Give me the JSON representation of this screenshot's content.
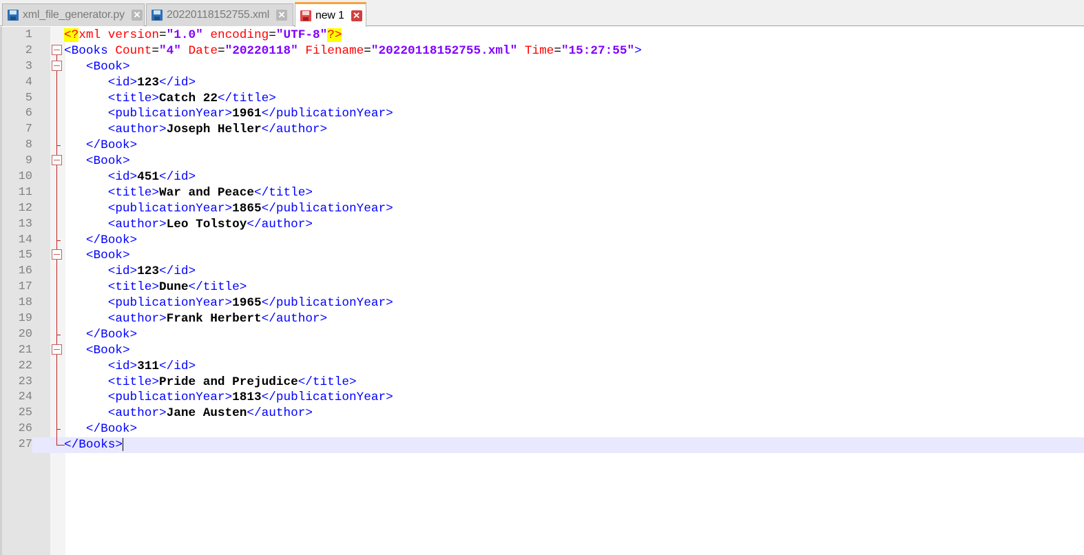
{
  "tabs": [
    {
      "label": "xml_file_generator.py",
      "icon": "saved-file-icon",
      "close": "✕",
      "active": false
    },
    {
      "label": "20220118152755.xml",
      "icon": "saved-file-icon",
      "close": "✕",
      "active": false
    },
    {
      "label": "new 1",
      "icon": "unsaved-file-icon",
      "close": "✕",
      "active": true
    }
  ],
  "editor": {
    "current_line": 27,
    "lines": [
      {
        "n": "1",
        "fold": "none"
      },
      {
        "n": "2",
        "fold": "open"
      },
      {
        "n": "3",
        "fold": "open"
      },
      {
        "n": "4",
        "fold": "body"
      },
      {
        "n": "5",
        "fold": "body"
      },
      {
        "n": "6",
        "fold": "body"
      },
      {
        "n": "7",
        "fold": "body"
      },
      {
        "n": "8",
        "fold": "end"
      },
      {
        "n": "9",
        "fold": "open"
      },
      {
        "n": "10",
        "fold": "body"
      },
      {
        "n": "11",
        "fold": "body"
      },
      {
        "n": "12",
        "fold": "body"
      },
      {
        "n": "13",
        "fold": "body"
      },
      {
        "n": "14",
        "fold": "end"
      },
      {
        "n": "15",
        "fold": "open"
      },
      {
        "n": "16",
        "fold": "body"
      },
      {
        "n": "17",
        "fold": "body"
      },
      {
        "n": "18",
        "fold": "body"
      },
      {
        "n": "19",
        "fold": "body"
      },
      {
        "n": "20",
        "fold": "end"
      },
      {
        "n": "21",
        "fold": "open"
      },
      {
        "n": "22",
        "fold": "body"
      },
      {
        "n": "23",
        "fold": "body"
      },
      {
        "n": "24",
        "fold": "body"
      },
      {
        "n": "25",
        "fold": "body"
      },
      {
        "n": "26",
        "fold": "end"
      },
      {
        "n": "27",
        "fold": "last"
      }
    ],
    "decl": {
      "open": "<?",
      "name": "xml",
      "a1": "version",
      "v1": "\"1.0\"",
      "a2": "encoding",
      "v2": "\"UTF-8\"",
      "close": "?>"
    },
    "root": {
      "tag": "Books",
      "attrs": [
        {
          "name": "Count",
          "value": "\"4\""
        },
        {
          "name": "Date",
          "value": "\"20220118\""
        },
        {
          "name": "Filename",
          "value": "\"20220118152755.xml\""
        },
        {
          "name": "Time",
          "value": "\"15:27:55\""
        }
      ]
    },
    "book_tag": "Book",
    "fields": [
      "id",
      "title",
      "publicationYear",
      "author"
    ],
    "books": [
      {
        "id": "123",
        "title": "Catch 22",
        "publicationYear": "1961",
        "author": "Joseph Heller"
      },
      {
        "id": "451",
        "title": "War and Peace",
        "publicationYear": "1865",
        "author": "Leo Tolstoy"
      },
      {
        "id": "123",
        "title": "Dune",
        "publicationYear": "1965",
        "author": "Frank Herbert"
      },
      {
        "id": "311",
        "title": "Pride and Prejudice",
        "publicationYear": "1813",
        "author": "Jane Austen"
      }
    ]
  },
  "colors": {
    "tag": "#0000ff",
    "attr": "#ff0000",
    "value": "#8000ff",
    "current_line": "#e8e8ff",
    "active_tab_accent": "#f7a33b"
  }
}
